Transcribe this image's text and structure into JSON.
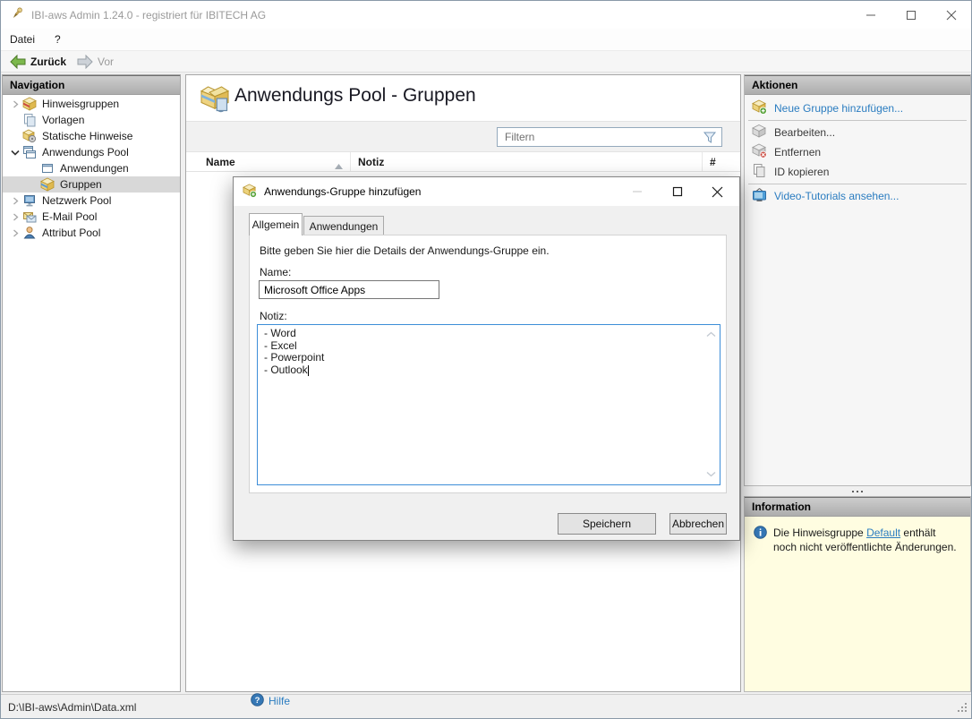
{
  "window": {
    "title": "IBI-aws Admin 1.24.0 - registriert für IBITECH AG"
  },
  "menubar": {
    "items": [
      {
        "label": "Datei"
      },
      {
        "label": "?"
      }
    ]
  },
  "toolbar": {
    "back": "Zurück",
    "forward": "Vor"
  },
  "navigation": {
    "header": "Navigation",
    "items": [
      {
        "label": "Hinweisgruppen",
        "state": "collapsed",
        "level": 1
      },
      {
        "label": "Vorlagen",
        "state": "none",
        "level": 1
      },
      {
        "label": "Statische Hinweise",
        "state": "none",
        "level": 1
      },
      {
        "label": "Anwendungs Pool",
        "state": "expanded",
        "level": 1
      },
      {
        "label": "Anwendungen",
        "state": "none",
        "level": 2
      },
      {
        "label": "Gruppen",
        "state": "none",
        "level": 2,
        "selected": true
      },
      {
        "label": "Netzwerk Pool",
        "state": "collapsed",
        "level": 1
      },
      {
        "label": "E-Mail Pool",
        "state": "collapsed",
        "level": 1
      },
      {
        "label": "Attribut Pool",
        "state": "collapsed",
        "level": 1
      }
    ]
  },
  "main": {
    "title": "Anwendungs Pool - Gruppen",
    "filter_placeholder": "Filtern",
    "columns": {
      "name": "Name",
      "notiz": "Notiz",
      "count": "#"
    }
  },
  "actions": {
    "header": "Aktionen",
    "items": [
      {
        "label": "Neue Gruppe hinzufügen...",
        "enabled": true
      },
      {
        "label": "Bearbeiten...",
        "enabled": false
      },
      {
        "label": "Entfernen",
        "enabled": false
      },
      {
        "label": "ID kopieren",
        "enabled": false
      },
      {
        "label": "Video-Tutorials ansehen...",
        "enabled": true
      }
    ]
  },
  "information": {
    "header": "Information",
    "text_before": "Die Hinweisgruppe ",
    "link_text": "Default",
    "text_after": " enthält noch nicht veröffentlichte Änderungen."
  },
  "dialog": {
    "title": "Anwendungs-Gruppe hinzufügen",
    "tabs": [
      {
        "label": "Allgemein"
      },
      {
        "label": "Anwendungen"
      }
    ],
    "instruction": "Bitte geben Sie hier die Details der Anwendungs-Gruppe ein.",
    "name_label": "Name:",
    "name_value": "Microsoft Office Apps",
    "notiz_label": "Notiz:",
    "notiz_value": "- Word\n- Excel\n- Powerpoint\n- Outlook",
    "help": "Hilfe",
    "save": "Speichern",
    "cancel": "Abbrechen"
  },
  "statusbar": {
    "path": "D:\\IBI-aws\\Admin\\Data.xml"
  },
  "colors": {
    "link": "#2a7cc0",
    "focus_border": "#3d8ed8",
    "info_bg": "#fffde1",
    "accent_green": "#76b041"
  }
}
